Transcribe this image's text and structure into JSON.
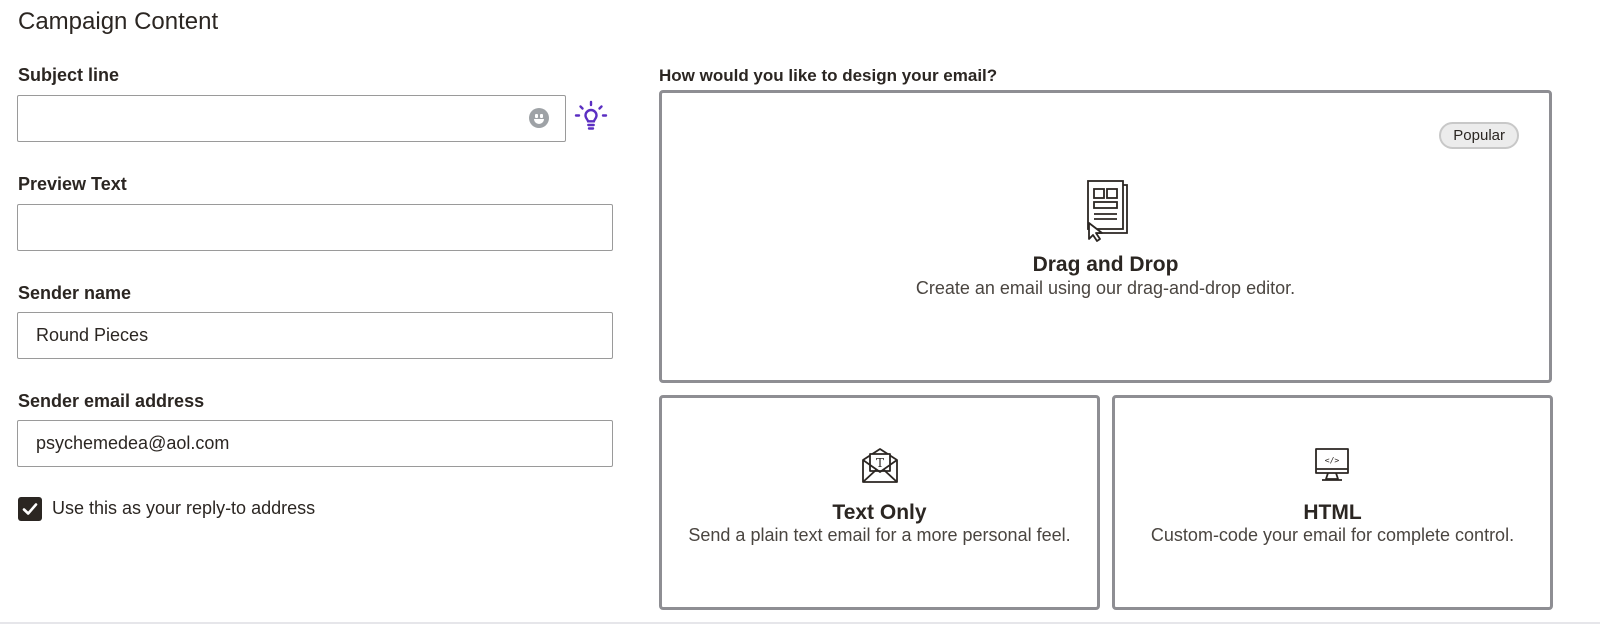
{
  "section_title": "Campaign Content",
  "subject": {
    "label": "Subject line",
    "value": "",
    "placeholder": ""
  },
  "preview": {
    "label": "Preview Text",
    "value": "",
    "placeholder": ""
  },
  "sender_name": {
    "label": "Sender name",
    "value": "Round Pieces"
  },
  "sender_email": {
    "label": "Sender email address",
    "value": "psychemedea@aol.com"
  },
  "reply_to": {
    "label": "Use this as your reply-to address",
    "checked": true
  },
  "design": {
    "question": "How would you like to design your email?",
    "options": [
      {
        "title": "Drag and Drop",
        "description": "Create an email using our drag-and-drop editor.",
        "badge": "Popular",
        "icon": "drag-drop-layout-icon"
      },
      {
        "title": "Text Only",
        "description": "Send a plain text email for a more personal feel.",
        "icon": "envelope-text-icon"
      },
      {
        "title": "HTML",
        "description": "Custom-code your email for complete control.",
        "icon": "monitor-code-icon"
      }
    ]
  },
  "colors": {
    "accent": "#5b2fc2",
    "border": "#8e8e93",
    "text": "#2b2622"
  }
}
